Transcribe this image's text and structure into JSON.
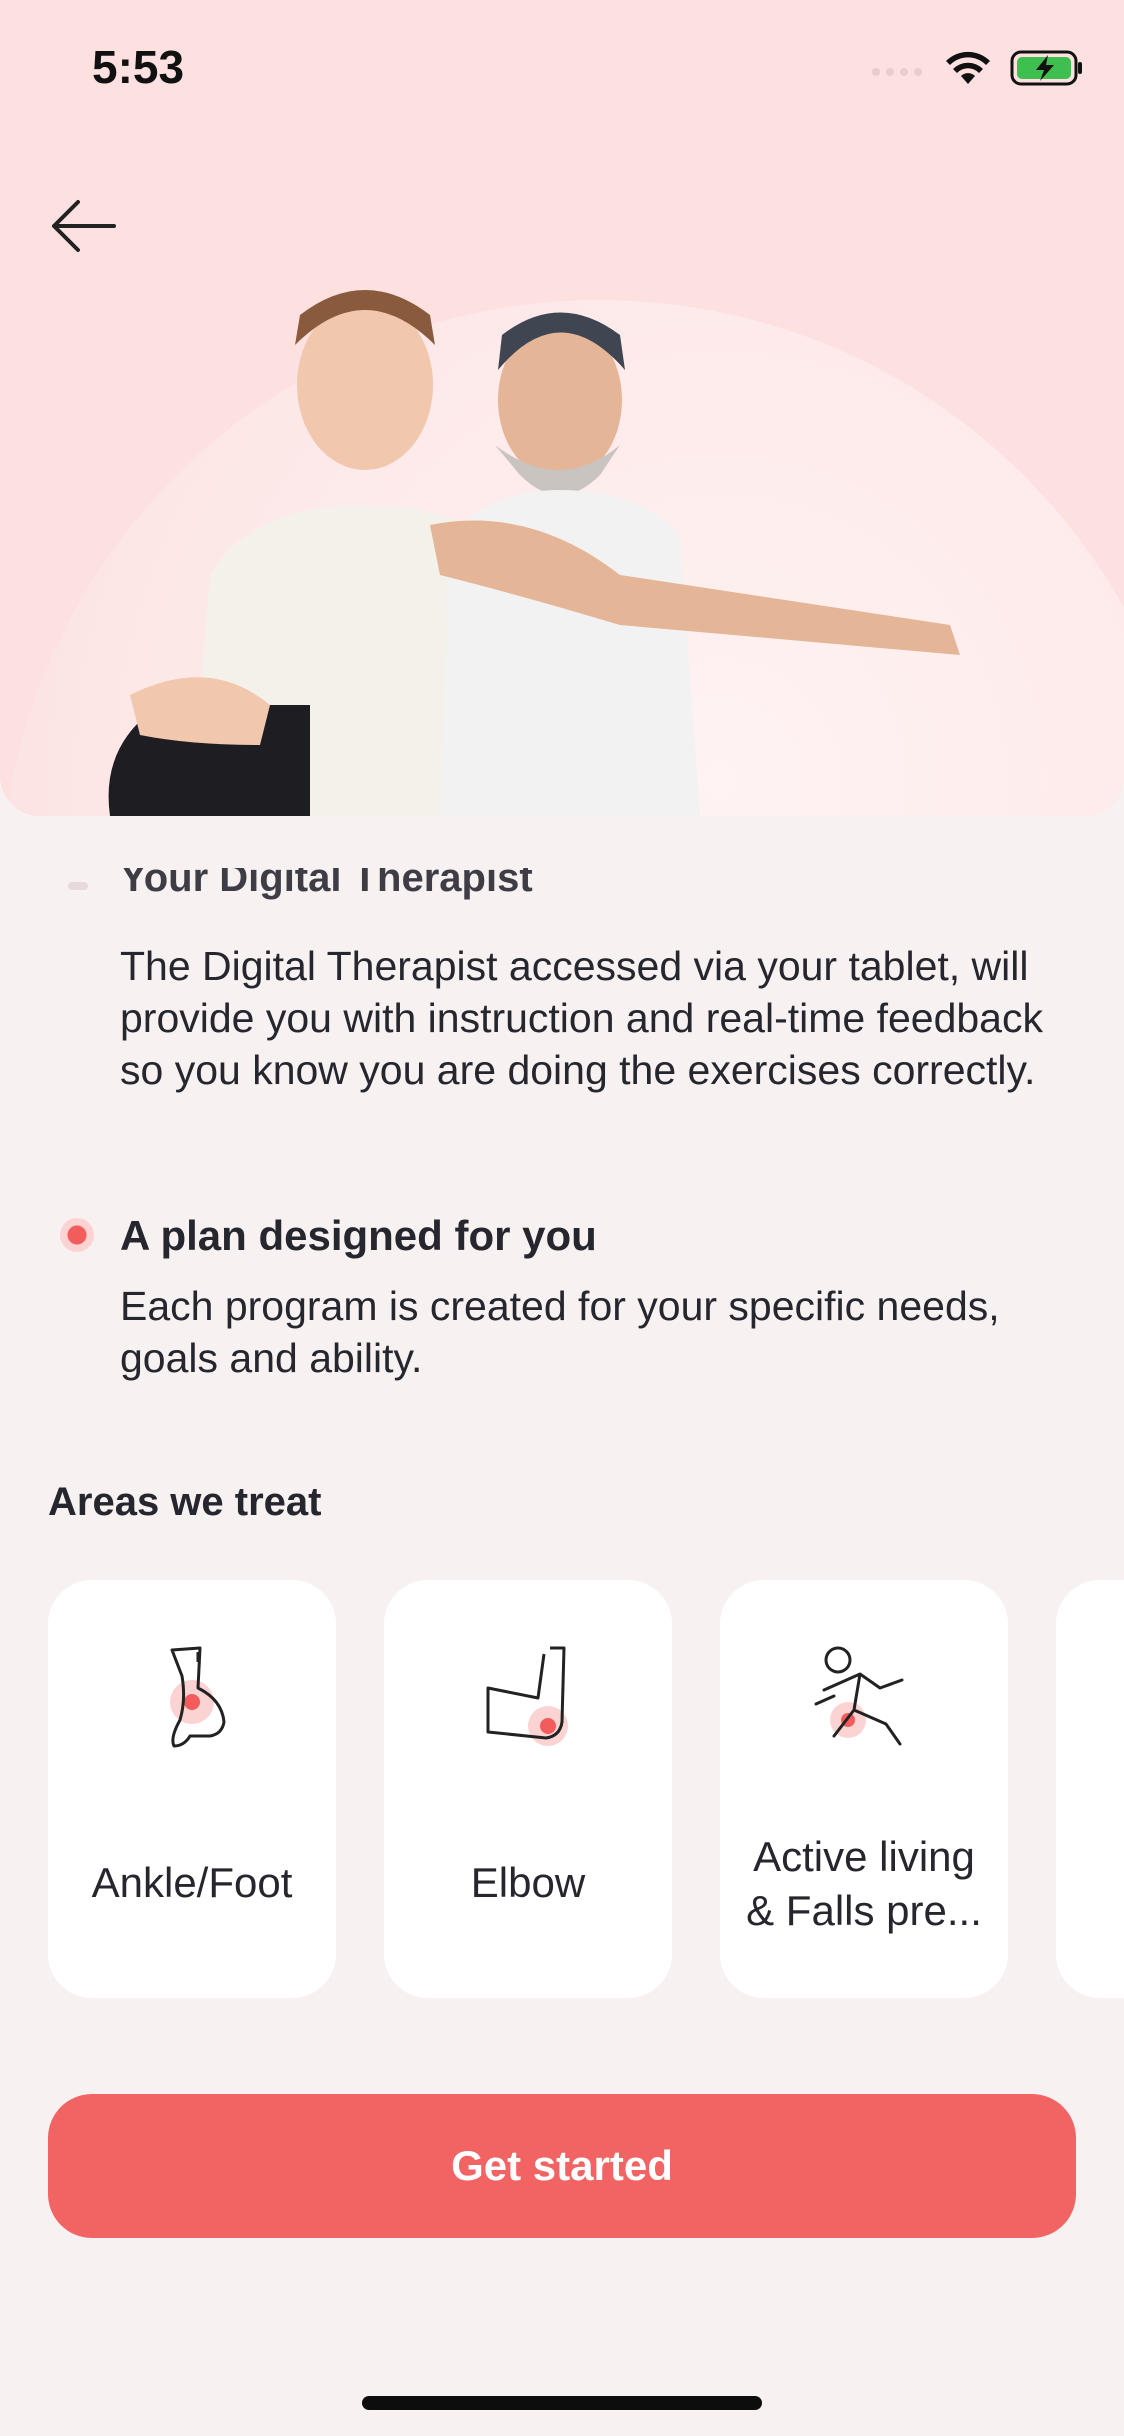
{
  "status_bar": {
    "time": "5:53"
  },
  "intro": {
    "faded_title": "Your Digital Therapist",
    "faded_paragraph": "The Digital Therapist accessed via your tablet, will provide you with instruction and real-time feedback so you know you are doing the exercises correctly."
  },
  "feature": {
    "title": "A plan designed for you",
    "description": "Each program is created for your specific needs, goals and ability."
  },
  "areas": {
    "title": "Areas we treat",
    "items": [
      {
        "label": "Ankle/Foot",
        "icon": "ankle-foot-icon"
      },
      {
        "label": "Elbow",
        "icon": "elbow-icon"
      },
      {
        "label": "Active living & Falls pre...",
        "icon": "active-living-icon"
      }
    ]
  },
  "cta": {
    "label": "Get started"
  },
  "colors": {
    "accent": "#f26363",
    "hero_bg": "#fde0e0",
    "page_bg": "#f7f2f1"
  }
}
